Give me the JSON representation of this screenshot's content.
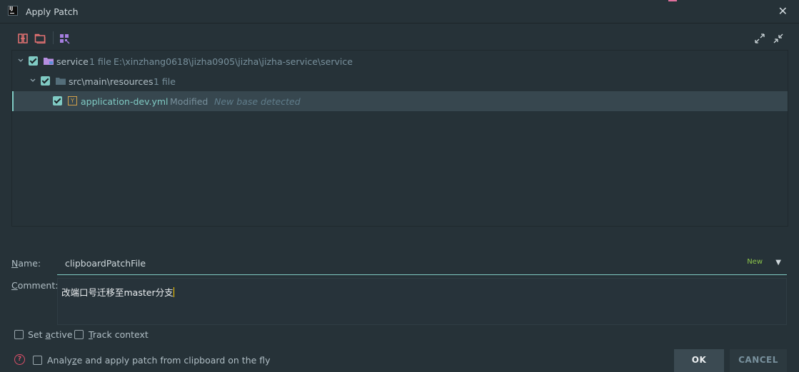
{
  "window": {
    "title": "Apply Patch"
  },
  "tree": {
    "root": {
      "label": "service",
      "count": "1 file",
      "path": "E:\\xinzhang0618\\jizha0905\\jizha\\jizha-service\\service"
    },
    "folder": {
      "label": "src\\main\\resources",
      "count": "1 file"
    },
    "file": {
      "label": "application-dev.yml",
      "status": "Modified",
      "note": "New base detected",
      "badge": "Y"
    }
  },
  "name": {
    "label_prefix": "",
    "label_mnemonic": "N",
    "label_rest": "ame:",
    "value": "clipboardPatchFile",
    "badge": "New"
  },
  "comment": {
    "label_mnemonic": "C",
    "label_rest": "omment:",
    "value": "改端口号迁移至master分支"
  },
  "options": {
    "set_active_pre": "Set ",
    "set_active_mn": "a",
    "set_active_post": "ctive",
    "track_mn": "T",
    "track_post": "rack context",
    "analyze_pre": "Analy",
    "analyze_mn": "z",
    "analyze_post": "e and apply patch from clipboard on the fly"
  },
  "buttons": {
    "ok": "OK",
    "cancel": "CANCEL"
  },
  "colors": {
    "accent": "#80cbc4",
    "background": "#263238",
    "selection": "#37474f"
  }
}
